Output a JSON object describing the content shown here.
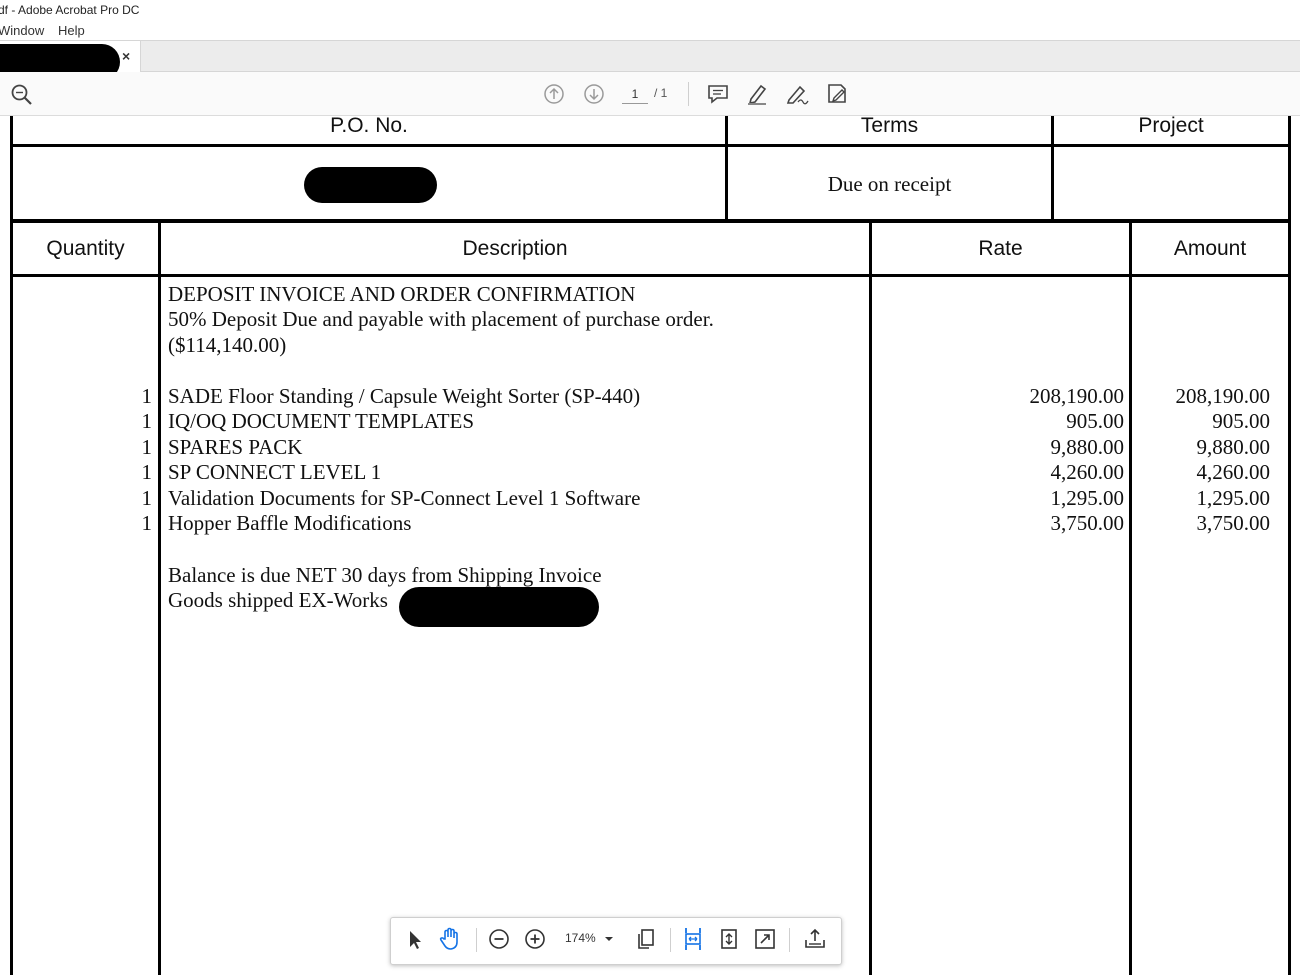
{
  "window": {
    "title": "df - Adobe Acrobat Pro DC"
  },
  "menu": {
    "items": [
      "Window",
      "Help"
    ]
  },
  "tab": {
    "close_label": "×"
  },
  "toolbar": {
    "page_current": "1",
    "page_total": "/ 1"
  },
  "invoice": {
    "header1": {
      "po": "P.O. No.",
      "terms": "Terms",
      "project": "Project"
    },
    "row1": {
      "terms_value": "Due on receipt"
    },
    "header2": {
      "quantity": "Quantity",
      "description": "Description",
      "rate": "Rate",
      "amount": "Amount"
    },
    "notes": [
      "DEPOSIT INVOICE AND ORDER CONFIRMATION",
      "50% Deposit Due and payable with placement of purchase order.",
      "($114,140.00)"
    ],
    "items": [
      {
        "qty": "1",
        "desc": "SADE Floor Standing / Capsule Weight Sorter (SP-440)",
        "rate": "208,190.00",
        "amount": "208,190.00"
      },
      {
        "qty": "1",
        "desc": "IQ/OQ DOCUMENT TEMPLATES",
        "rate": "905.00",
        "amount": "905.00"
      },
      {
        "qty": "1",
        "desc": "SPARES PACK",
        "rate": "9,880.00",
        "amount": "9,880.00"
      },
      {
        "qty": "1",
        "desc": "SP CONNECT LEVEL 1",
        "rate": "4,260.00",
        "amount": "4,260.00"
      },
      {
        "qty": "1",
        "desc": "Validation Documents for SP-Connect Level 1 Software",
        "rate": "1,295.00",
        "amount": "1,295.00"
      },
      {
        "qty": "1",
        "desc": "Hopper Baffle Modifications",
        "rate": "3,750.00",
        "amount": "3,750.00"
      }
    ],
    "footer_notes": [
      "Balance is due NET 30 days from Shipping Invoice",
      "Goods shipped EX-Works"
    ]
  },
  "bottom_toolbar": {
    "zoom": "174%"
  },
  "colors": {
    "accent": "#1473e6",
    "redaction": "#000000",
    "icon": "#444444"
  }
}
